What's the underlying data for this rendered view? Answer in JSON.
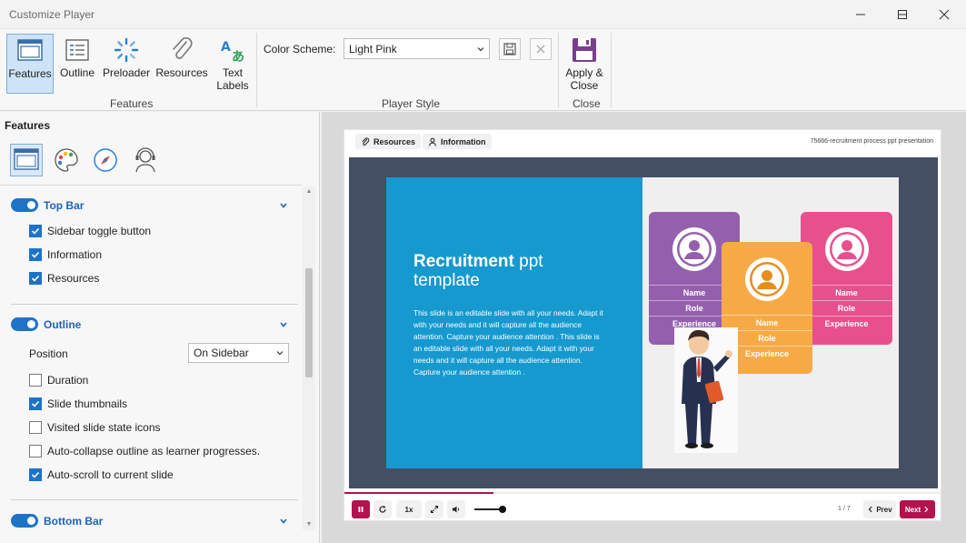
{
  "window": {
    "title": "Customize Player"
  },
  "ribbon": {
    "features_group": {
      "label": "Features",
      "buttons": [
        {
          "label": "Features",
          "icon": "layout-icon",
          "active": true
        },
        {
          "label": "Outline",
          "icon": "outline-icon"
        },
        {
          "label": "Preloader",
          "icon": "spinner-icon"
        },
        {
          "label": "Resources",
          "icon": "paperclip-icon"
        },
        {
          "label": "Text Labels",
          "icon": "translate-icon"
        }
      ]
    },
    "player_style_group": {
      "label": "Player Style",
      "color_scheme_label": "Color Scheme:",
      "color_scheme_value": "Light Pink"
    },
    "close_group": {
      "label": "Close",
      "apply_close_label": "Apply & Close"
    }
  },
  "left_panel": {
    "title": "Features",
    "tabs": [
      "layout-icon",
      "palette-icon",
      "compass-icon",
      "support-icon"
    ],
    "sections": {
      "top_bar": {
        "title": "Top Bar",
        "enabled": true,
        "options": [
          {
            "label": "Sidebar toggle button",
            "checked": true
          },
          {
            "label": "Information",
            "checked": true
          },
          {
            "label": "Resources",
            "checked": true
          }
        ]
      },
      "outline": {
        "title": "Outline",
        "enabled": true,
        "position_label": "Position",
        "position_value": "On Sidebar",
        "options": [
          {
            "label": "Duration",
            "checked": false
          },
          {
            "label": "Slide thumbnails",
            "checked": true
          },
          {
            "label": "Visited slide state icons",
            "checked": false
          },
          {
            "label": "Auto-collapse outline as learner progresses.",
            "checked": false
          },
          {
            "label": "Auto-scroll to current slide",
            "checked": true
          }
        ]
      },
      "bottom_bar": {
        "title": "Bottom Bar",
        "enabled": true
      }
    }
  },
  "player": {
    "tabs": {
      "resources": "Resources",
      "information": "Information"
    },
    "presentation_title": "75666-recruitment process ppt presentation",
    "slide": {
      "title_bold": "Recruitment",
      "title_rest": " ppt template",
      "body": "This slide is an editable slide with all your needs. Adapt it with your needs and it will capture all the audience attention. Capture your audience attention . This slide is an editable slide with all your needs. Adapt it with your needs and it will capture all the audience attention. Capture your audience attention .",
      "cards": [
        {
          "name": "Name",
          "role": "Role",
          "experience": "Experience",
          "color": "#9460ae"
        },
        {
          "name": "Name",
          "role": "Role",
          "experience": "Experience",
          "color": "#f6aa45"
        },
        {
          "name": "Name",
          "role": "Role",
          "experience": "Experience",
          "color": "#e8508d"
        }
      ]
    },
    "controls": {
      "speed": "1x",
      "page_indicator": "1 / 7",
      "prev_label": "Prev",
      "next_label": "Next",
      "progress": 0.25
    },
    "accent_color": "#b3124f"
  }
}
